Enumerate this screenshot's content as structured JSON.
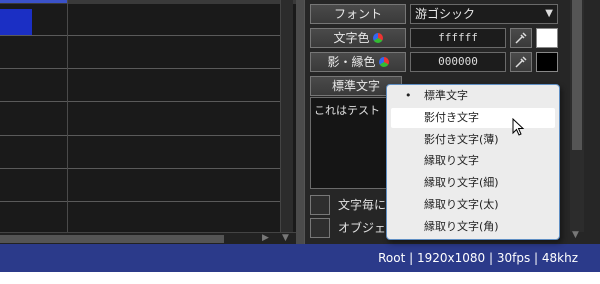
{
  "panel": {
    "font_button": "フォント",
    "font_value": "游ゴシック",
    "text_color_button": "文字色",
    "text_color_value": "ffffff",
    "shadow_color_button": "影・縁色",
    "shadow_color_value": "000000",
    "style_button": "標準文字",
    "text_content": "これはテスト",
    "checkbox1_label": "文字毎に",
    "checkbox2_label": "オブジェク"
  },
  "dropdown": {
    "items": [
      "標準文字",
      "影付き文字",
      "影付き文字(薄)",
      "縁取り文字",
      "縁取り文字(細)",
      "縁取り文字(太)",
      "縁取り文字(角)"
    ],
    "selected_bullet": "•"
  },
  "statusbar": {
    "text": "Root  |  1920x1080  |  30fps  |  48khz"
  },
  "colors": {
    "text_color": "#ffffff",
    "shadow_color": "#000000",
    "status_bg": "#2b3a8a",
    "clip_blue": "#1b2fc4"
  }
}
